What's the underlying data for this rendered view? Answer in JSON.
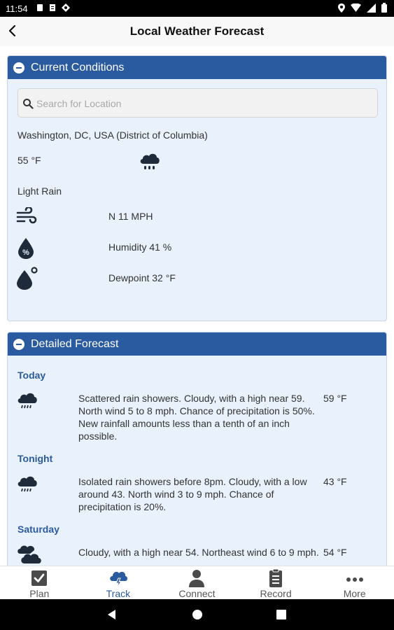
{
  "status": {
    "time": "11:54"
  },
  "header": {
    "title": "Local Weather Forecast"
  },
  "current": {
    "section_title": "Current Conditions",
    "search_placeholder": "Search for Location",
    "location": "Washington, DC, USA (District of Columbia)",
    "temperature": "55 °F",
    "condition": "Light Rain",
    "wind": "N 11 MPH",
    "humidity": "Humidity 41 %",
    "dewpoint": "Dewpoint 32 °F"
  },
  "forecast": {
    "section_title": "Detailed Forecast",
    "periods": [
      {
        "name": "Today",
        "description": "Scattered rain showers. Cloudy, with a high near 59. North wind 5 to 8 mph. Chance of precipitation is 50%. New rainfall amounts less than a tenth of an inch possible.",
        "temp": "59 °F"
      },
      {
        "name": "Tonight",
        "description": "Isolated rain showers before 8pm. Cloudy, with a low around 43. North wind 3 to 9 mph. Chance of precipitation is 20%.",
        "temp": "43 °F"
      },
      {
        "name": "Saturday",
        "description": "Cloudy, with a high near 54. Northeast wind 6 to 9 mph.",
        "temp": "54 °F"
      }
    ]
  },
  "nav": {
    "items": [
      {
        "label": "Plan",
        "icon": "checkbox-icon"
      },
      {
        "label": "Track",
        "icon": "storm-cloud-icon"
      },
      {
        "label": "Connect",
        "icon": "person-icon"
      },
      {
        "label": "Record",
        "icon": "clipboard-icon"
      },
      {
        "label": "More",
        "icon": "dots-icon"
      }
    ],
    "active": "Track"
  },
  "colors": {
    "accent": "#2a5aa0",
    "panel_bg": "#e8f1fc",
    "icon_dark": "#1f2a3a"
  }
}
